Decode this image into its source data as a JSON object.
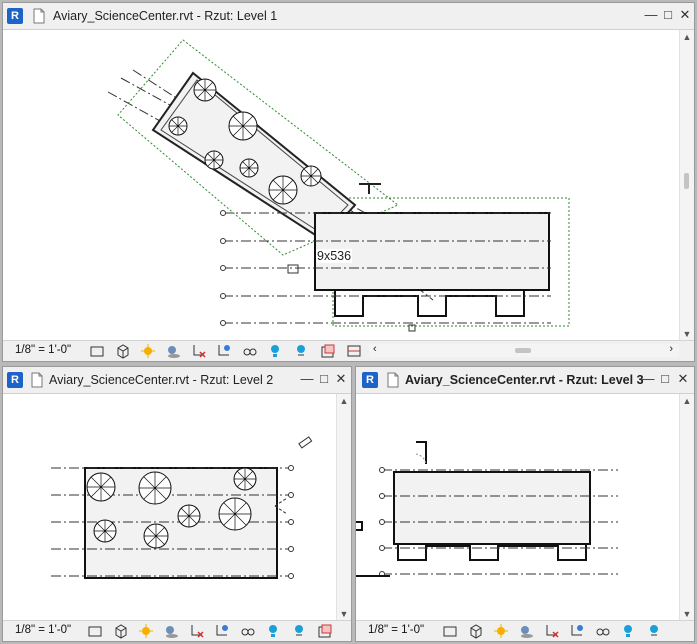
{
  "windows": {
    "level1": {
      "title": "Aviary_ScienceCenter.rvt - Rzut: Level 1",
      "scale": "1/8\" = 1'-0\"",
      "dimension_label": "9x536"
    },
    "level2": {
      "title": "Aviary_ScienceCenter.rvt - Rzut: Level 2",
      "scale": "1/8\" = 1'-0\""
    },
    "level3": {
      "title": "Aviary_ScienceCenter.rvt - Rzut: Level 3",
      "scale": "1/8\" = 1'-0\""
    }
  },
  "app_logo": "R",
  "controls": {
    "minimize": "—",
    "maximize": "□",
    "close": "✕"
  },
  "colors": {
    "accent": "#1d63c8",
    "crop_region": "#2e8b2e",
    "hidden_tool": "#d03030"
  },
  "icons": [
    "detail-level-icon",
    "visual-style-icon",
    "sun-path-icon",
    "shadows-icon",
    "crop-view-icon",
    "show-crop-icon",
    "unlock-3d-icon",
    "temporary-hide-icon",
    "reveal-hidden-icon",
    "analysis-display-icon",
    "highlight-displacement-icon",
    "reveal-constraints-icon"
  ]
}
